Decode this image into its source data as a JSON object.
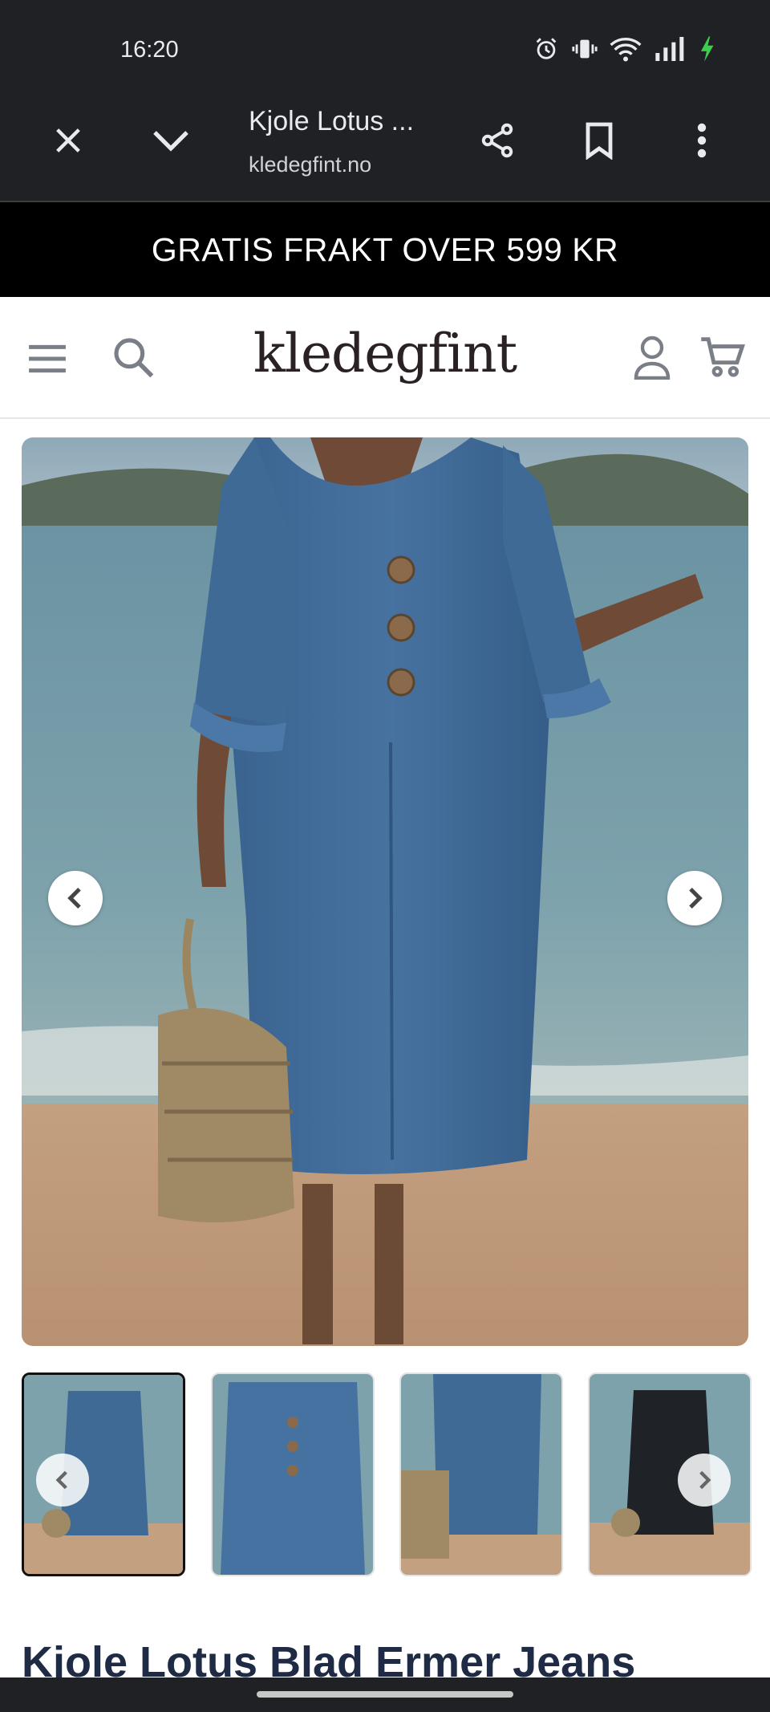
{
  "status_bar": {
    "time": "16:20",
    "icons": [
      "alarm-icon",
      "vibrate-icon",
      "wifi-icon",
      "signal-icon",
      "battery-charging-icon"
    ]
  },
  "browser": {
    "page_title": "Kjole Lotus ...",
    "url": "kledegfint.no",
    "buttons": [
      "close-icon",
      "chevron-down-icon",
      "share-icon",
      "bookmark-icon",
      "more-vert-icon"
    ]
  },
  "announcement": {
    "text": "GRATIS FRAKT OVER 599 KR"
  },
  "header": {
    "logo": "kledegfint",
    "icons": [
      "menu-icon",
      "search-icon",
      "account-icon",
      "cart-icon"
    ]
  },
  "gallery": {
    "thumbnail_count": 4,
    "active_thumbnail": 1,
    "colors": {
      "denim": "#3f6a96",
      "sea": "#6b93a3",
      "sand": "#c3a080",
      "black_variant": "#1f2328"
    }
  },
  "product": {
    "title": "Kjole Lotus Blad Ermer Jeans"
  }
}
